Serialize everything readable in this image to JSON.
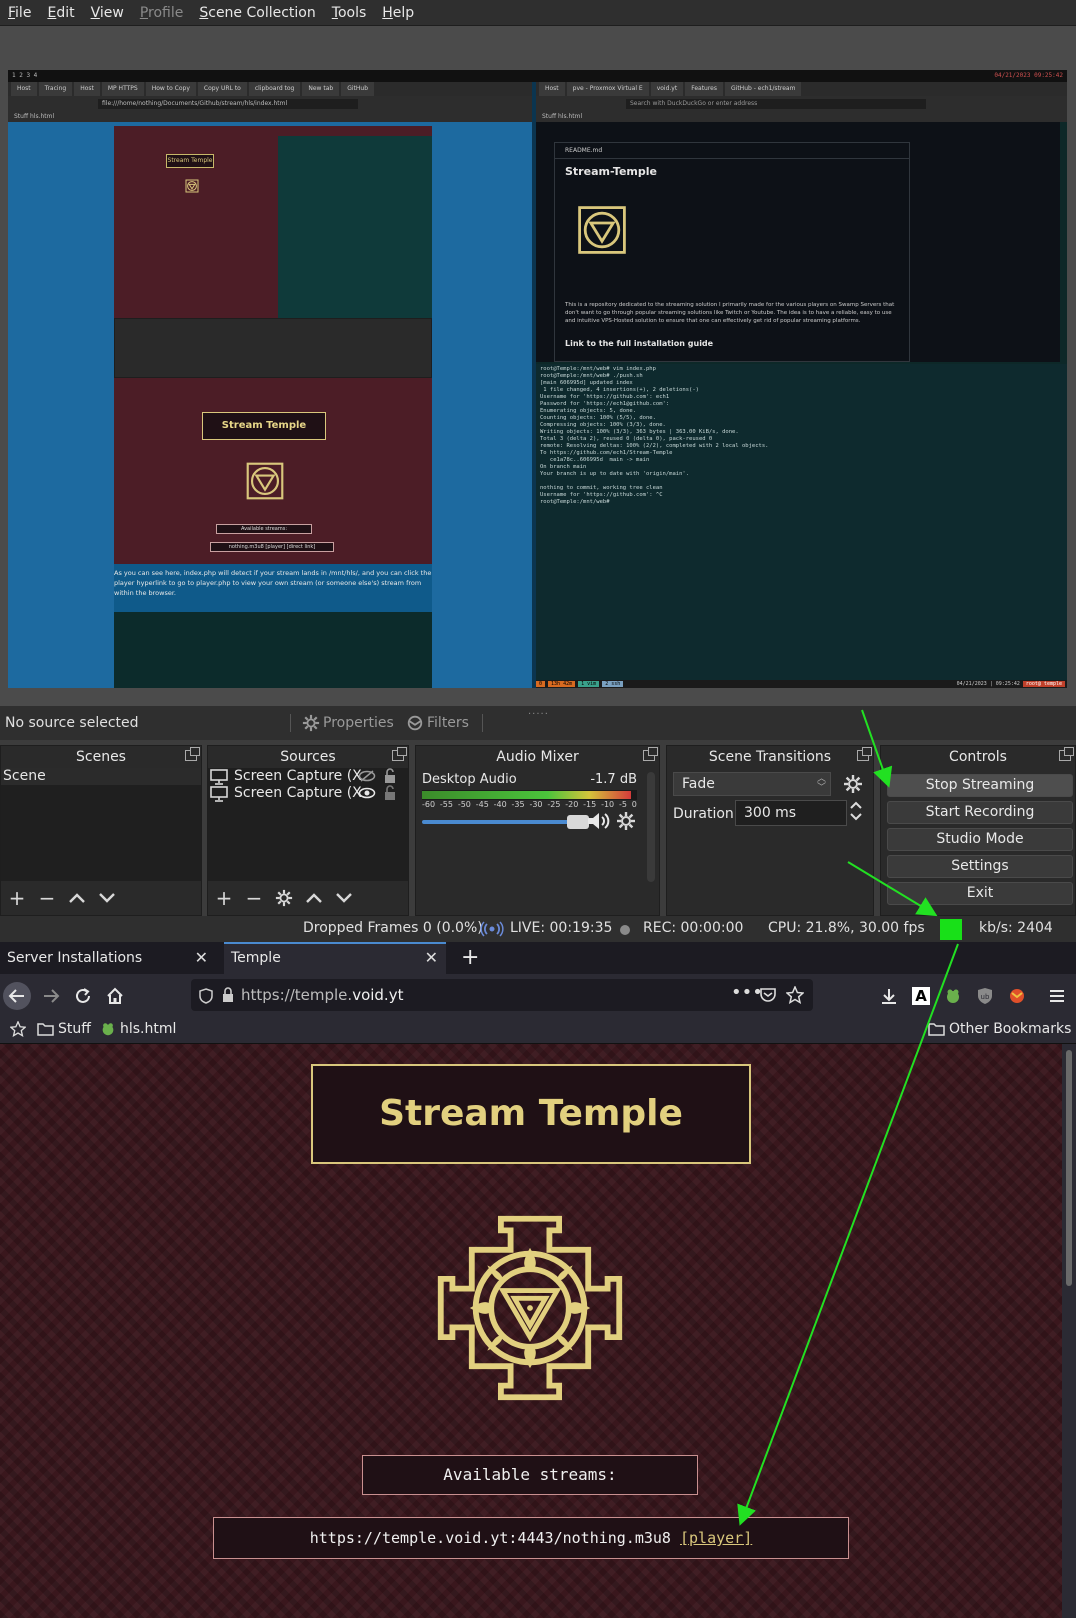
{
  "menubar": {
    "items": [
      {
        "label": "File",
        "enabled": true
      },
      {
        "label": "Edit",
        "enabled": true
      },
      {
        "label": "View",
        "enabled": true
      },
      {
        "label": "Profile",
        "enabled": false
      },
      {
        "label": "Scene Collection",
        "enabled": true
      },
      {
        "label": "Tools",
        "enabled": true
      },
      {
        "label": "Help",
        "enabled": true
      }
    ]
  },
  "preview": {
    "left_tabs": [
      "Host",
      "Tracing",
      "Host",
      "MP HTTPS",
      "How to Copy",
      "Copy URL to",
      "clipboard tog",
      "New tab",
      "GitHub"
    ],
    "left_url": "file:///home/nothing/Documents/Github/stream/hls/index.html",
    "left_bookmarks": "Stuff  hls.html",
    "nested_title": "Stream Temple",
    "nested_streams": "Available streams:",
    "nested_url": "nothing.m3u8 [player] [direct link]",
    "caption": "As you can see here, index.php will detect if your stream lands in /mnt/hls/, and you can click the player hyperlink to go to player.php to view your own stream (or someone else's) stream from within the browser.",
    "right_tabs": [
      "Host",
      "pve - Proxmox Virtual E",
      "void.yt",
      "Features",
      "GitHub - ech1/stream"
    ],
    "right_url": "Search with DuckDuckGo or enter address",
    "readme_header": "README.md",
    "readme_title": "Stream-Temple",
    "readme_desc": "This is a repository dedicated to the streaming solution I primarily made for the various players on Swamp Servers that don't want to go through popular streaming solutions like Twitch or Youtube. The idea is to have a reliable, easy to use and intuitive VPS-Hosted solution to ensure that one can effectively get rid of popular streaming platforms.",
    "readme_link": "Link to the full installation guide",
    "terminal": "root@Temple:/mnt/web# vim index.php\nroot@Temple:/mnt/web# ./push.sh\n[main 606995d] updated index\n 1 file changed, 4 insertions(+), 2 deletions(-)\nUsername for 'https://github.com': ech1\nPassword for 'https://ech1@github.com':\nEnumerating objects: 5, done.\nCounting objects: 100% (5/5), done.\nCompressing objects: 100% (3/3), done.\nWriting objects: 100% (3/3), 363 bytes | 363.00 KiB/s, done.\nTotal 3 (delta 2), reused 0 (delta 0), pack-reused 0\nremote: Resolving deltas: 100% (2/2), completed with 2 local objects.\nTo https://github.com/ech1/Stream-Temple\n   ce1a78c..606995d  main -> main\nOn branch main\nYour branch is up to date with 'origin/main'.\n\nnothing to commit, working tree clean\nUsername for 'https://github.com': ^C\nroot@Temple:/mnt/web# ",
    "status_left": [
      "0",
      "13h 42m",
      "1 vim",
      "2 ssh"
    ],
    "status_right": "04/21/2023 | 09:25:42",
    "status_host": "root@ temple"
  },
  "source_toolbar": {
    "no_source": "No source selected",
    "properties": "Properties",
    "filters": "Filters"
  },
  "docks": {
    "scenes": {
      "title": "Scenes",
      "items": [
        "Scene"
      ]
    },
    "sources": {
      "title": "Sources",
      "items": [
        "Screen Capture (X",
        "Screen Capture (X"
      ]
    },
    "mixer": {
      "title": "Audio Mixer",
      "channel": "Desktop Audio",
      "level": "-1.7 dB",
      "ticks": [
        "-60",
        "-55",
        "-50",
        "-45",
        "-40",
        "-35",
        "-30",
        "-25",
        "-20",
        "-15",
        "-10",
        "-5",
        "0"
      ],
      "volume_fraction": 0.9
    },
    "transitions": {
      "title": "Scene Transitions",
      "selected": "Fade",
      "duration_label": "Duration",
      "duration_value": "300 ms"
    },
    "controls": {
      "title": "Controls",
      "buttons": [
        "Stop Streaming",
        "Start Recording",
        "Studio Mode",
        "Settings",
        "Exit"
      ]
    }
  },
  "statusbar": {
    "dropped": "Dropped Frames 0 (0.0%)",
    "live": "LIVE: 00:19:35",
    "rec": "REC: 00:00:00",
    "cpu": "CPU: 21.8%, 30.00 fps",
    "kbs": "kb/s: 2404",
    "health_color": "#18e018"
  },
  "firefox": {
    "tabs": [
      {
        "title": "Server Installations",
        "active": false
      },
      {
        "title": "Temple",
        "active": true
      }
    ],
    "url_prefix": "https://temple.",
    "url_domain": "void.yt",
    "bookmarks": [
      {
        "label": "Stuff",
        "icon": "folder-icon"
      },
      {
        "label": "hls.html",
        "icon": "frog-icon"
      }
    ],
    "other_bookmarks": "Other Bookmarks"
  },
  "page": {
    "title": "Stream Temple",
    "streams_label": "Available streams:",
    "stream_url": "https://temple.void.yt:4443/nothing.m3u8",
    "player_link": "[player]"
  },
  "colors": {
    "accent_gold": "#d9c77c",
    "page_bg": "#3a171d",
    "arrow": "#22e022"
  }
}
